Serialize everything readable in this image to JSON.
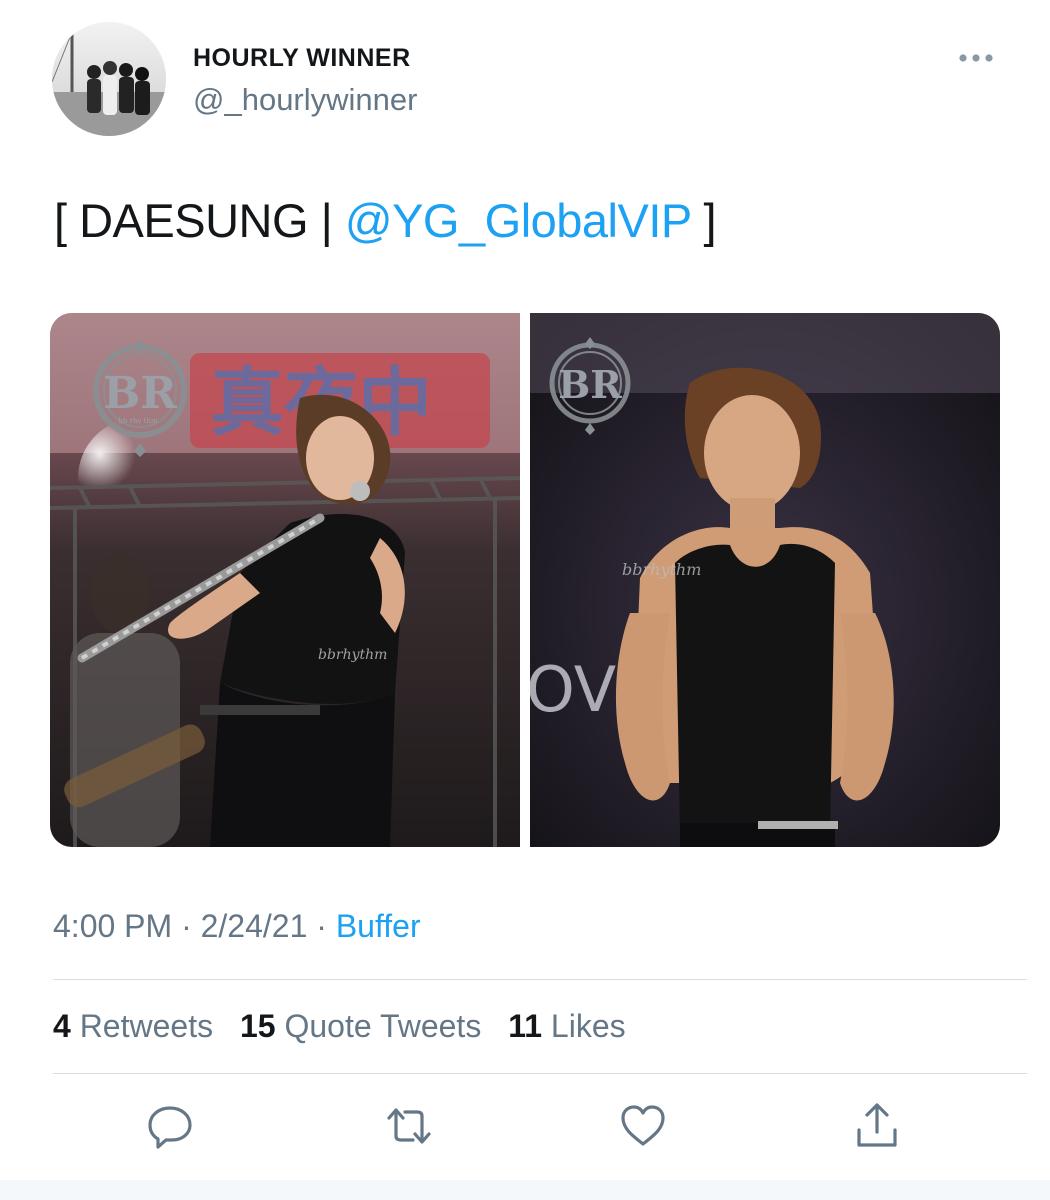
{
  "author": {
    "display_name": "HOURLY WINNER",
    "handle": "@_hourlywinner"
  },
  "tweet": {
    "text_prefix": "[ DAESUNG | ",
    "mention": "@YG_GlobalVIP",
    "text_suffix": " ]"
  },
  "media": {
    "left_photo": {
      "logo_letters": "BR",
      "logo_small": "bb rhy thm",
      "watermark": "bbrhythm",
      "banner_text": "真夜中"
    },
    "right_photo": {
      "logo_letters": "BR",
      "watermark": "bbrhythm",
      "background_text": "OV"
    }
  },
  "meta": {
    "time": "4:00 PM",
    "date": "2/24/21",
    "separator": " · ",
    "source": "Buffer"
  },
  "stats": {
    "retweets_count": "4",
    "retweets_label": "Retweets",
    "quotes_count": "15",
    "quotes_label": "Quote Tweets",
    "likes_count": "11",
    "likes_label": "Likes"
  },
  "actions": [
    "reply-icon",
    "retweet-icon",
    "like-icon",
    "share-icon"
  ],
  "colors": {
    "accent": "#1da1f2",
    "secondary_text": "#657786",
    "primary_text": "#14171a",
    "divider": "#d8dde1"
  }
}
